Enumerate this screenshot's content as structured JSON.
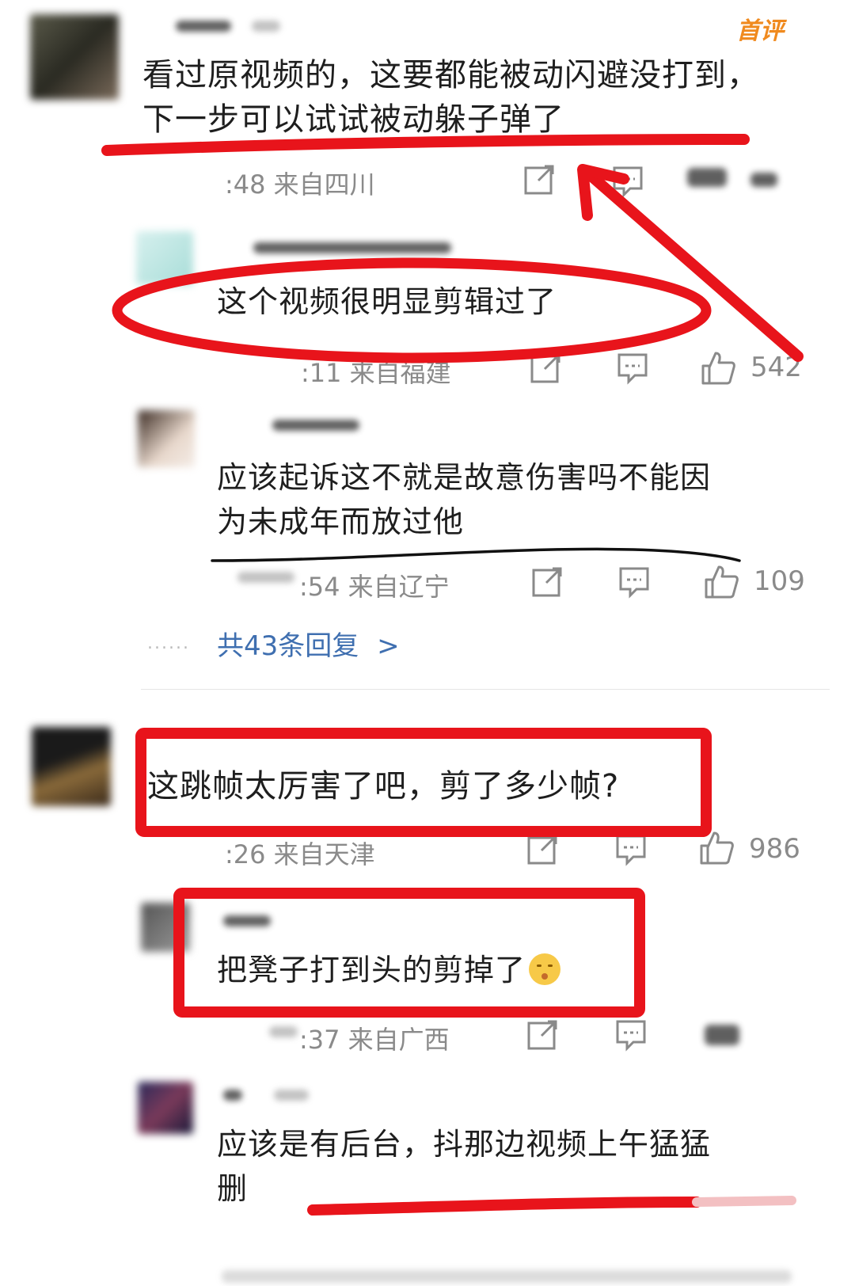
{
  "colors": {
    "annotation_red": "#e8141b",
    "link_blue": "#3f6fb0",
    "meta_gray": "#8a8a8a",
    "badge_orange": "#f08a1e"
  },
  "comments": [
    {
      "badge": "首评",
      "lines": [
        "看过原视频的，这要都能被动闪避没打到，",
        "下一步可以试试被动躲子弹了"
      ],
      "time": ":48 来自四川",
      "icons": [
        "share-icon",
        "reply-icon",
        "like-icon"
      ]
    },
    {
      "lines": [
        "这个视频很明显剪辑过了"
      ],
      "time": ":11 来自福建",
      "likes": "542"
    },
    {
      "lines": [
        "应该起诉这不就是故意伤害吗不能因",
        "为未成年而放过他"
      ],
      "time": ":54 来自辽宁",
      "likes": "109"
    },
    {
      "lines": [
        "这跳帧太厉害了吧，剪了多少帧?"
      ],
      "time": ":26 来自天津",
      "likes": "986"
    },
    {
      "lines": [
        "把凳子打到头的剪掉了"
      ],
      "time": ":37 来自广西",
      "emoji": "shush-emoji"
    },
    {
      "lines": [
        "应该是有后台，抖那边视频上午猛猛",
        "删"
      ]
    }
  ],
  "replies_link": "共43条回复",
  "replies_chevron": ">",
  "dots": "......"
}
